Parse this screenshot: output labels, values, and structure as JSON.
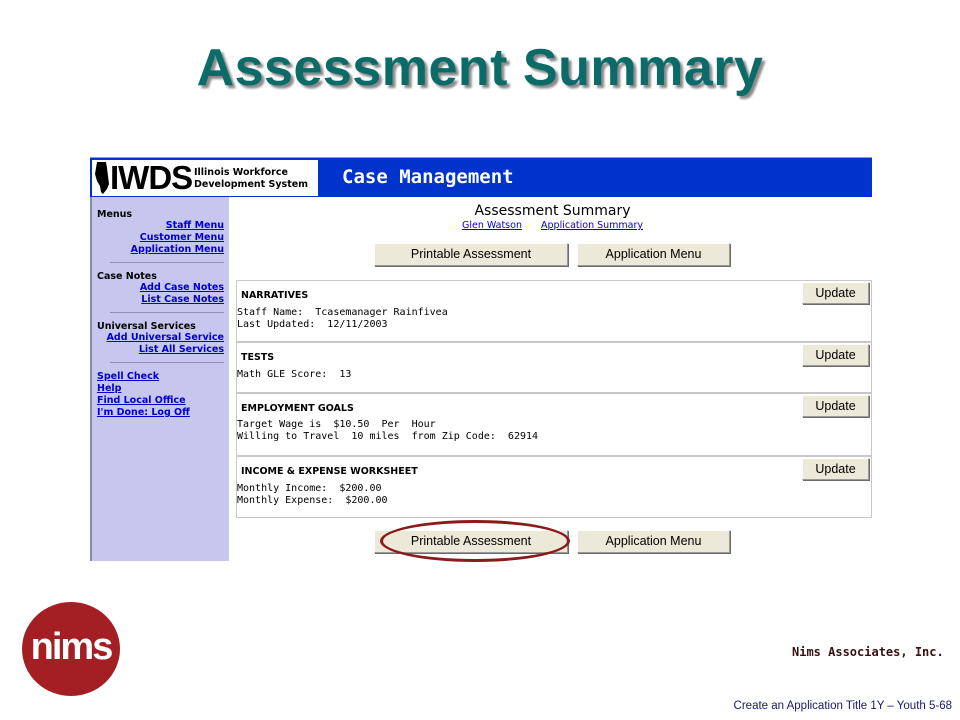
{
  "slide": {
    "title": "Assessment Summary",
    "company": "Nims Associates, Inc.",
    "footer": "Create an Application Title 1Y – Youth 5-68",
    "logo_text": "nims"
  },
  "banner": {
    "logo_text": "IWDS",
    "logo_sub_line1": "Illinois Workforce",
    "logo_sub_line2": "Development System",
    "title": "Case Management"
  },
  "sidebar": {
    "menus": {
      "heading": "Menus",
      "items": [
        "Staff Menu",
        "Customer Menu",
        "Application Menu"
      ]
    },
    "case_notes": {
      "heading": "Case Notes",
      "items": [
        "Add Case Notes",
        "List Case Notes"
      ]
    },
    "universal_services": {
      "heading": "Universal Services",
      "items": [
        "Add Universal Service",
        "List All Services"
      ]
    },
    "misc": [
      "Spell Check",
      "Help",
      "Find Local Office",
      "I'm Done: Log Off"
    ]
  },
  "content": {
    "title": "Assessment Summary",
    "link_customer": "Glen Watson",
    "link_summary": "Application Summary",
    "btn_printable": "Printable Assessment",
    "btn_app_menu": "Application Menu",
    "update_label": "Update",
    "panels": {
      "narratives": {
        "heading": "NARRATIVES",
        "line1": "Staff Name:  Tcasemanager Rainfivea",
        "line2": "Last Updated:  12/11/2003"
      },
      "tests": {
        "heading": "TESTS",
        "line1": "Math GLE Score:  13"
      },
      "employment": {
        "heading": "EMPLOYMENT GOALS",
        "line1": "Target Wage is  $10.50  Per  Hour",
        "line2": "Willing to Travel  10 miles  from Zip Code:  62914"
      },
      "income": {
        "heading": "INCOME & EXPENSE WORKSHEET",
        "line1": "Monthly Income:  $200.00",
        "line2": "Monthly Expense:  $200.00"
      }
    }
  },
  "colors": {
    "title": "#0b6b68",
    "banner": "#0033cc",
    "sidebar": "#c6c6ee",
    "link": "#0000cc",
    "ring": "#8b1a1a",
    "logo": "#a31f24"
  }
}
